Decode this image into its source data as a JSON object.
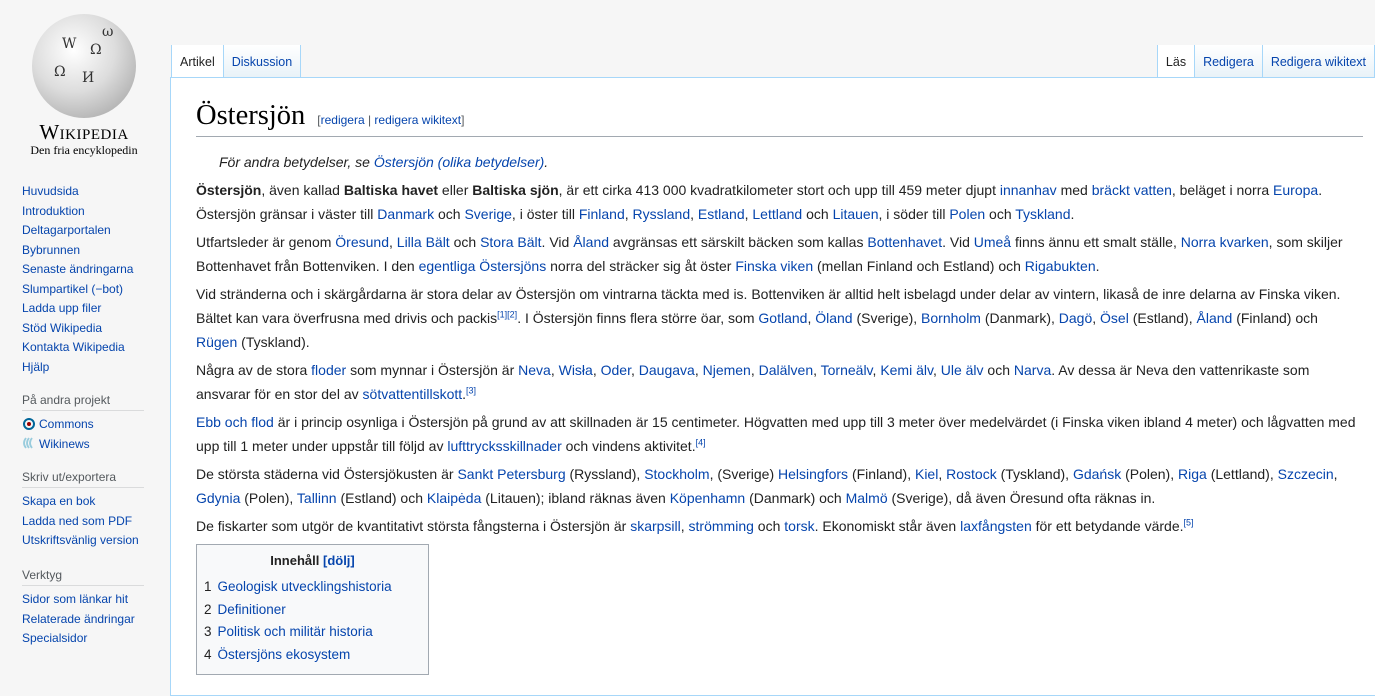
{
  "logo": {
    "wordmark": "Wikipedia",
    "tagline": "Den fria encyklopedin"
  },
  "nav": [
    "Huvudsida",
    "Introduktion",
    "Deltagarportalen",
    "Bybrunnen",
    "Senaste ändringarna",
    "Slumpartikel (−bot)",
    "Ladda upp filer",
    "Stöd Wikipedia",
    "Kontakta Wikipedia",
    "Hjälp"
  ],
  "other_projects": {
    "heading": "På andra projekt",
    "items": [
      "Commons",
      "Wikinews"
    ]
  },
  "export": {
    "heading": "Skriv ut/exportera",
    "items": [
      "Skapa en bok",
      "Ladda ned som PDF",
      "Utskriftsvänlig version"
    ]
  },
  "tools": {
    "heading": "Verktyg",
    "items": [
      "Sidor som länkar hit",
      "Relaterade ändringar",
      "Specialsidor"
    ]
  },
  "tabs_left": [
    "Artikel",
    "Diskussion"
  ],
  "tabs_right": [
    "Läs",
    "Redigera",
    "Redigera wikitext"
  ],
  "title": "Östersjön",
  "editsection": {
    "open": "[",
    "edit": "redigera",
    "sep": " | ",
    "edit_source": "redigera wikitext",
    "close": "]"
  },
  "hatnote": {
    "prefix": "För andra betydelser, se ",
    "link": "Östersjön (olika betydelser)",
    "suffix": "."
  },
  "paragraphs": [
    [
      {
        "t": "Östersjön",
        "b": 1
      },
      {
        "t": ", även kallad "
      },
      {
        "t": "Baltiska havet",
        "b": 1
      },
      {
        "t": " eller "
      },
      {
        "t": "Baltiska sjön",
        "b": 1
      },
      {
        "t": ", är ett cirka 413 000 kvadratkilometer stort och upp till 459 meter djupt "
      },
      {
        "t": "innanhav",
        "l": 1
      },
      {
        "t": " med "
      },
      {
        "t": "bräckt vatten",
        "l": 1
      },
      {
        "t": ", beläget i norra "
      },
      {
        "t": "Europa",
        "l": 1
      },
      {
        "t": ". Östersjön gränsar i väster till "
      },
      {
        "t": "Danmark",
        "l": 1
      },
      {
        "t": " och "
      },
      {
        "t": "Sverige",
        "l": 1
      },
      {
        "t": ", i öster till "
      },
      {
        "t": "Finland",
        "l": 1
      },
      {
        "t": ", "
      },
      {
        "t": "Ryssland",
        "l": 1
      },
      {
        "t": ", "
      },
      {
        "t": "Estland",
        "l": 1
      },
      {
        "t": ", "
      },
      {
        "t": "Lettland",
        "l": 1
      },
      {
        "t": " och "
      },
      {
        "t": "Litauen",
        "l": 1
      },
      {
        "t": ", i söder till "
      },
      {
        "t": "Polen",
        "l": 1
      },
      {
        "t": " och "
      },
      {
        "t": "Tyskland",
        "l": 1
      },
      {
        "t": "."
      }
    ],
    [
      {
        "t": "Utfartsleder är genom "
      },
      {
        "t": "Öresund",
        "l": 1
      },
      {
        "t": ", "
      },
      {
        "t": "Lilla Bält",
        "l": 1
      },
      {
        "t": " och "
      },
      {
        "t": "Stora Bält",
        "l": 1
      },
      {
        "t": ". Vid "
      },
      {
        "t": "Åland",
        "l": 1
      },
      {
        "t": " avgränsas ett särskilt bäcken som kallas "
      },
      {
        "t": "Bottenhavet",
        "l": 1
      },
      {
        "t": ". Vid "
      },
      {
        "t": "Umeå",
        "l": 1
      },
      {
        "t": " finns ännu ett smalt ställe, "
      },
      {
        "t": "Norra kvarken",
        "l": 1
      },
      {
        "t": ", som skiljer Bottenhavet från Bottenviken. I "
      },
      {
        "t": "den "
      },
      {
        "t": "egentliga Östersjöns",
        "l": 1
      },
      {
        "t": " norra del sträcker sig åt öster "
      },
      {
        "t": "Finska viken",
        "l": 1
      },
      {
        "t": " (mellan Finland och Estland) och "
      },
      {
        "t": "Rigabukten",
        "l": 1
      },
      {
        "t": "."
      }
    ],
    [
      {
        "t": "Vid stränderna och i skärgårdarna är stora delar av Östersjön om vintrarna täckta med is. Bottenviken är alltid helt isbelagd under delar av vintern, likaså de inre delarna av Finska viken. Bältet kan vara "
      },
      {
        "t": "överfrusna med drivis och packis"
      },
      {
        "t": "[1]",
        "s": 1
      },
      {
        "t": "[2]",
        "s": 1
      },
      {
        "t": ". I Östersjön finns flera större öar, som "
      },
      {
        "t": "Gotland",
        "l": 1
      },
      {
        "t": ", "
      },
      {
        "t": "Öland",
        "l": 1
      },
      {
        "t": " (Sverige), "
      },
      {
        "t": "Bornholm",
        "l": 1
      },
      {
        "t": " (Danmark), "
      },
      {
        "t": "Dagö",
        "l": 1
      },
      {
        "t": ", "
      },
      {
        "t": "Ösel",
        "l": 1
      },
      {
        "t": " (Estland), "
      },
      {
        "t": "Åland",
        "l": 1
      },
      {
        "t": " (Finland) och "
      },
      {
        "t": "Rügen",
        "l": 1
      },
      {
        "t": " (Tyskland)."
      }
    ],
    [
      {
        "t": "Några av de stora "
      },
      {
        "t": "floder",
        "l": 1
      },
      {
        "t": " som mynnar i Östersjön är "
      },
      {
        "t": "Neva",
        "l": 1
      },
      {
        "t": ", "
      },
      {
        "t": "Wisła",
        "l": 1
      },
      {
        "t": ", "
      },
      {
        "t": "Oder",
        "l": 1
      },
      {
        "t": ", "
      },
      {
        "t": "Daugava",
        "l": 1
      },
      {
        "t": ", "
      },
      {
        "t": "Njemen",
        "l": 1
      },
      {
        "t": ", "
      },
      {
        "t": "Dalälven",
        "l": 1
      },
      {
        "t": ", "
      },
      {
        "t": "Torneälv",
        "l": 1
      },
      {
        "t": ", "
      },
      {
        "t": "Kemi älv",
        "l": 1
      },
      {
        "t": ", "
      },
      {
        "t": "Ule älv",
        "l": 1
      },
      {
        "t": " och "
      },
      {
        "t": "Narva",
        "l": 1
      },
      {
        "t": ". Av dessa är Neva den vattenrikaste som ansvarar för en stor del av "
      },
      {
        "t": "sötvattentillskott",
        "l": 1
      },
      {
        "t": "."
      },
      {
        "t": "[3]",
        "s": 1
      }
    ],
    [
      {
        "t": "Ebb och flod",
        "l": 1
      },
      {
        "t": " är i princip osynliga i Östersjön på grund av att skillnaden är 15 centimeter. Högvatten med upp till 3 meter över medelvärdet (i Finska viken ibland 4 meter) och lågvatten med upp till 1 meter under "
      },
      {
        "t": "uppstår till följd av "
      },
      {
        "t": "lufttrycksskillnader",
        "l": 1
      },
      {
        "t": " och vindens aktivitet."
      },
      {
        "t": "[4]",
        "s": 1
      }
    ],
    [
      {
        "t": "De största städerna vid Östersjökusten är "
      },
      {
        "t": "Sankt Petersburg",
        "l": 1
      },
      {
        "t": " (Ryssland), "
      },
      {
        "t": "Stockholm",
        "l": 1
      },
      {
        "t": ", (Sverige) "
      },
      {
        "t": "Helsingfors",
        "l": 1
      },
      {
        "t": " (Finland), "
      },
      {
        "t": "Kiel",
        "l": 1
      },
      {
        "t": ", "
      },
      {
        "t": "Rostock",
        "l": 1
      },
      {
        "t": " (Tyskland), "
      },
      {
        "t": "Gdańsk",
        "l": 1
      },
      {
        "t": " (Polen), "
      },
      {
        "t": "Riga",
        "l": 1
      },
      {
        "t": " (Lettland), "
      },
      {
        "t": "Szczecin",
        "l": 1
      },
      {
        "t": ", "
      },
      {
        "t": "Gdynia",
        "l": 1
      },
      {
        "t": " (Polen), "
      },
      {
        "t": "Tallinn",
        "l": 1
      },
      {
        "t": " (Estland) och "
      },
      {
        "t": "Klaipėda",
        "l": 1
      },
      {
        "t": " (Litauen); ibland räknas även "
      },
      {
        "t": "Köpenhamn",
        "l": 1
      },
      {
        "t": " (Danmark) och "
      },
      {
        "t": "Malmö",
        "l": 1
      },
      {
        "t": " (Sverige), då även Öresund ofta räknas in."
      }
    ],
    [
      {
        "t": "De fiskarter som utgör de kvantitativt största fångsterna i Östersjön är "
      },
      {
        "t": "skarpsill",
        "l": 1
      },
      {
        "t": ", "
      },
      {
        "t": "strömming",
        "l": 1
      },
      {
        "t": " och "
      },
      {
        "t": "torsk",
        "l": 1
      },
      {
        "t": ". Ekonomiskt står även "
      },
      {
        "t": "laxfångsten",
        "l": 1
      },
      {
        "t": " för ett betydande värde."
      },
      {
        "t": "[5]",
        "s": 1
      }
    ]
  ],
  "toc": {
    "title": "Innehåll",
    "toggle": "[dölj]",
    "items": [
      {
        "num": "1",
        "label": "Geologisk utvecklingshistoria"
      },
      {
        "num": "2",
        "label": "Definitioner"
      },
      {
        "num": "3",
        "label": "Politisk och militär historia"
      },
      {
        "num": "4",
        "label": "Östersjöns ekosystem"
      }
    ]
  }
}
